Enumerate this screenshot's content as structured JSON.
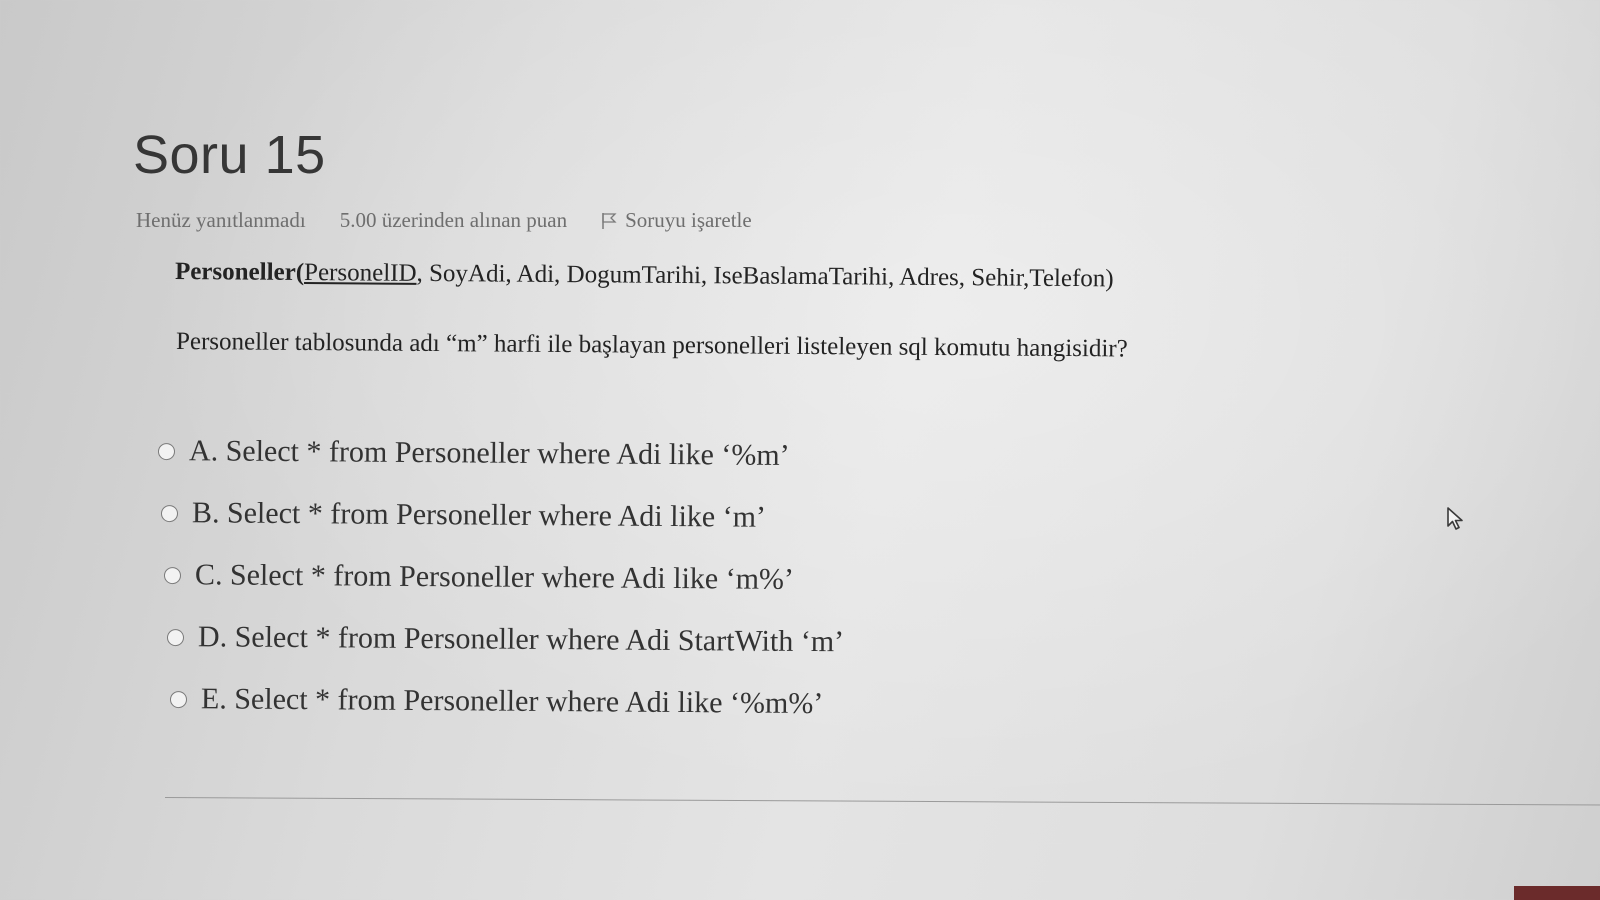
{
  "question": {
    "title": "Soru 15",
    "state": "Henüz yanıtlanmadı",
    "grade": "5.00 üzerinden alınan puan",
    "flag_label": "Soruyu işaretle"
  },
  "schema": {
    "table": "Personeller(",
    "primary_key": "PersonelID",
    "columns": ", SoyAdi, Adi, DogumTarihi, IseBaslamaTarihi, Adres, Sehir,Telefon)"
  },
  "question_text": "Personeller tablosunda adı “m” harfi ile başlayan personelleri listeleyen sql komutu hangisidir?",
  "answers": [
    {
      "label": "A. Select * from Personeller where Adi like ‘%m’"
    },
    {
      "label": "B. Select * from Personeller where Adi like ‘m’"
    },
    {
      "label": "C. Select * from Personeller where Adi like ‘m%’"
    },
    {
      "label": "D. Select * from Personeller where Adi StartWith ‘m’"
    },
    {
      "label": "E. Select * from Personeller where Adi like ‘%m%’"
    }
  ],
  "icons": {
    "flag": "flag-icon",
    "cursor": "mouse-cursor-icon",
    "radio": "radio-button"
  },
  "colors": {
    "text": "#232323",
    "muted": "#6e6e6e",
    "accent_corner": "#6b2b2b"
  }
}
